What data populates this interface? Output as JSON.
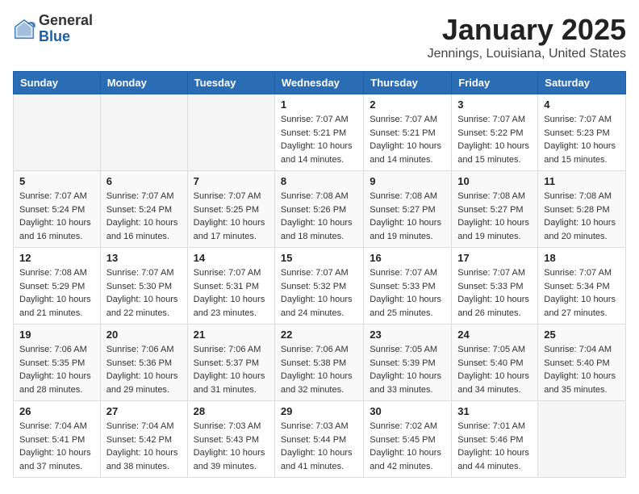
{
  "logo": {
    "general": "General",
    "blue": "Blue"
  },
  "title": "January 2025",
  "location": "Jennings, Louisiana, United States",
  "days_header": [
    "Sunday",
    "Monday",
    "Tuesday",
    "Wednesday",
    "Thursday",
    "Friday",
    "Saturday"
  ],
  "weeks": [
    [
      {
        "day": "",
        "info": ""
      },
      {
        "day": "",
        "info": ""
      },
      {
        "day": "",
        "info": ""
      },
      {
        "day": "1",
        "info": "Sunrise: 7:07 AM\nSunset: 5:21 PM\nDaylight: 10 hours\nand 14 minutes."
      },
      {
        "day": "2",
        "info": "Sunrise: 7:07 AM\nSunset: 5:21 PM\nDaylight: 10 hours\nand 14 minutes."
      },
      {
        "day": "3",
        "info": "Sunrise: 7:07 AM\nSunset: 5:22 PM\nDaylight: 10 hours\nand 15 minutes."
      },
      {
        "day": "4",
        "info": "Sunrise: 7:07 AM\nSunset: 5:23 PM\nDaylight: 10 hours\nand 15 minutes."
      }
    ],
    [
      {
        "day": "5",
        "info": "Sunrise: 7:07 AM\nSunset: 5:24 PM\nDaylight: 10 hours\nand 16 minutes."
      },
      {
        "day": "6",
        "info": "Sunrise: 7:07 AM\nSunset: 5:24 PM\nDaylight: 10 hours\nand 16 minutes."
      },
      {
        "day": "7",
        "info": "Sunrise: 7:07 AM\nSunset: 5:25 PM\nDaylight: 10 hours\nand 17 minutes."
      },
      {
        "day": "8",
        "info": "Sunrise: 7:08 AM\nSunset: 5:26 PM\nDaylight: 10 hours\nand 18 minutes."
      },
      {
        "day": "9",
        "info": "Sunrise: 7:08 AM\nSunset: 5:27 PM\nDaylight: 10 hours\nand 19 minutes."
      },
      {
        "day": "10",
        "info": "Sunrise: 7:08 AM\nSunset: 5:27 PM\nDaylight: 10 hours\nand 19 minutes."
      },
      {
        "day": "11",
        "info": "Sunrise: 7:08 AM\nSunset: 5:28 PM\nDaylight: 10 hours\nand 20 minutes."
      }
    ],
    [
      {
        "day": "12",
        "info": "Sunrise: 7:08 AM\nSunset: 5:29 PM\nDaylight: 10 hours\nand 21 minutes."
      },
      {
        "day": "13",
        "info": "Sunrise: 7:07 AM\nSunset: 5:30 PM\nDaylight: 10 hours\nand 22 minutes."
      },
      {
        "day": "14",
        "info": "Sunrise: 7:07 AM\nSunset: 5:31 PM\nDaylight: 10 hours\nand 23 minutes."
      },
      {
        "day": "15",
        "info": "Sunrise: 7:07 AM\nSunset: 5:32 PM\nDaylight: 10 hours\nand 24 minutes."
      },
      {
        "day": "16",
        "info": "Sunrise: 7:07 AM\nSunset: 5:33 PM\nDaylight: 10 hours\nand 25 minutes."
      },
      {
        "day": "17",
        "info": "Sunrise: 7:07 AM\nSunset: 5:33 PM\nDaylight: 10 hours\nand 26 minutes."
      },
      {
        "day": "18",
        "info": "Sunrise: 7:07 AM\nSunset: 5:34 PM\nDaylight: 10 hours\nand 27 minutes."
      }
    ],
    [
      {
        "day": "19",
        "info": "Sunrise: 7:06 AM\nSunset: 5:35 PM\nDaylight: 10 hours\nand 28 minutes."
      },
      {
        "day": "20",
        "info": "Sunrise: 7:06 AM\nSunset: 5:36 PM\nDaylight: 10 hours\nand 29 minutes."
      },
      {
        "day": "21",
        "info": "Sunrise: 7:06 AM\nSunset: 5:37 PM\nDaylight: 10 hours\nand 31 minutes."
      },
      {
        "day": "22",
        "info": "Sunrise: 7:06 AM\nSunset: 5:38 PM\nDaylight: 10 hours\nand 32 minutes."
      },
      {
        "day": "23",
        "info": "Sunrise: 7:05 AM\nSunset: 5:39 PM\nDaylight: 10 hours\nand 33 minutes."
      },
      {
        "day": "24",
        "info": "Sunrise: 7:05 AM\nSunset: 5:40 PM\nDaylight: 10 hours\nand 34 minutes."
      },
      {
        "day": "25",
        "info": "Sunrise: 7:04 AM\nSunset: 5:40 PM\nDaylight: 10 hours\nand 35 minutes."
      }
    ],
    [
      {
        "day": "26",
        "info": "Sunrise: 7:04 AM\nSunset: 5:41 PM\nDaylight: 10 hours\nand 37 minutes."
      },
      {
        "day": "27",
        "info": "Sunrise: 7:04 AM\nSunset: 5:42 PM\nDaylight: 10 hours\nand 38 minutes."
      },
      {
        "day": "28",
        "info": "Sunrise: 7:03 AM\nSunset: 5:43 PM\nDaylight: 10 hours\nand 39 minutes."
      },
      {
        "day": "29",
        "info": "Sunrise: 7:03 AM\nSunset: 5:44 PM\nDaylight: 10 hours\nand 41 minutes."
      },
      {
        "day": "30",
        "info": "Sunrise: 7:02 AM\nSunset: 5:45 PM\nDaylight: 10 hours\nand 42 minutes."
      },
      {
        "day": "31",
        "info": "Sunrise: 7:01 AM\nSunset: 5:46 PM\nDaylight: 10 hours\nand 44 minutes."
      },
      {
        "day": "",
        "info": ""
      }
    ]
  ]
}
